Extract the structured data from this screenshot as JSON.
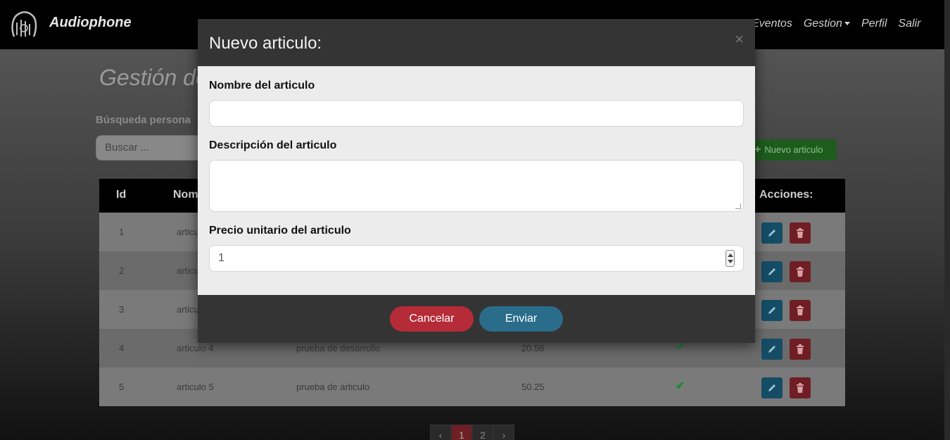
{
  "navbar": {
    "brand": "Audiophone",
    "links": [
      "Eventos",
      "Gestion",
      "Perfil",
      "Salir"
    ]
  },
  "page": {
    "title": "Gestión de",
    "search_label": "Búsqueda persona",
    "search_placeholder": "Buscar ...",
    "new_button": "Nuevo articulo"
  },
  "table": {
    "headers": {
      "id": "Id",
      "name": "Nom",
      "actions": "Acciones:"
    },
    "rows": [
      {
        "id": "1",
        "name": "articu",
        "description": "",
        "price": "",
        "active": false
      },
      {
        "id": "2",
        "name": "articu",
        "description": "",
        "price": "",
        "active": false
      },
      {
        "id": "3",
        "name": "articu",
        "description": "",
        "price": "",
        "active": false
      },
      {
        "id": "4",
        "name": "articulo 4",
        "description": "prueba de desarrollo",
        "price": "20.56",
        "active": true
      },
      {
        "id": "5",
        "name": "articulo 5",
        "description": "prueba de articulo",
        "price": "50.25",
        "active": true
      }
    ]
  },
  "pagination": {
    "prev": "‹",
    "pages": [
      "1",
      "2"
    ],
    "next": "›",
    "current": "1"
  },
  "modal": {
    "title": "Nuevo articulo:",
    "close": "×",
    "fields": {
      "name_label": "Nombre del articulo",
      "name_value": "",
      "desc_label": "Descripción del articulo",
      "desc_value": "",
      "price_label": "Precio unitario del articulo",
      "price_value": "1"
    },
    "cancel_label": "Cancelar",
    "submit_label": "Enviar"
  },
  "colors": {
    "cancel": "#b52b37",
    "submit": "#2a6d8a",
    "edit": "#154d66",
    "delete": "#6e1e24",
    "success": "#1c8a3a"
  }
}
